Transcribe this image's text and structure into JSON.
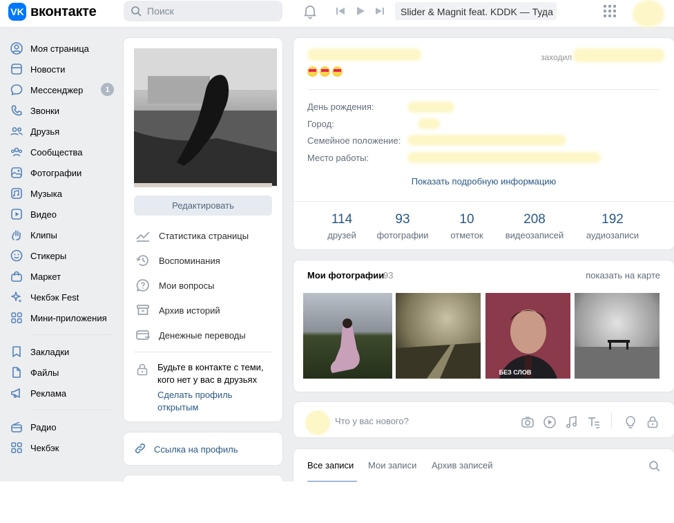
{
  "topbar": {
    "logo_mark": "VK",
    "logo_text": "вконтакте",
    "search_placeholder": "Поиск",
    "player_track": "Slider & Magnit feat. KDDK — Туда",
    "icons": [
      "search-icon",
      "bell-icon",
      "prev-icon",
      "play-icon",
      "next-icon",
      "apps-grid-icon"
    ]
  },
  "sidebar": {
    "items": [
      {
        "label": "Моя страница",
        "icon": "user-icon"
      },
      {
        "label": "Новости",
        "icon": "news-icon"
      },
      {
        "label": "Мессенджер",
        "icon": "chat-icon",
        "badge": "1"
      },
      {
        "label": "Звонки",
        "icon": "phone-icon"
      },
      {
        "label": "Друзья",
        "icon": "friends-icon"
      },
      {
        "label": "Сообщества",
        "icon": "groups-icon"
      },
      {
        "label": "Фотографии",
        "icon": "photo-icon"
      },
      {
        "label": "Музыка",
        "icon": "music-icon"
      },
      {
        "label": "Видео",
        "icon": "video-icon"
      },
      {
        "label": "Клипы",
        "icon": "clips-icon"
      },
      {
        "label": "Стикеры",
        "icon": "sticker-icon"
      },
      {
        "label": "Маркет",
        "icon": "market-icon"
      },
      {
        "label": "Чекбэк Fest",
        "icon": "sparkle-icon"
      },
      {
        "label": "Мини-приложения",
        "icon": "apps-icon"
      }
    ],
    "secondary": [
      {
        "label": "Закладки",
        "icon": "bookmark-icon"
      },
      {
        "label": "Файлы",
        "icon": "file-icon"
      },
      {
        "label": "Реклама",
        "icon": "ads-icon"
      }
    ],
    "tertiary": [
      {
        "label": "Радио",
        "icon": "radio-icon"
      },
      {
        "label": "Чекбэк",
        "icon": "apps-icon"
      }
    ]
  },
  "profile_card": {
    "edit_button": "Редактировать",
    "menu": [
      {
        "label": "Статистика страницы",
        "icon": "stats-icon"
      },
      {
        "label": "Воспоминания",
        "icon": "history-icon"
      },
      {
        "label": "Мои вопросы",
        "icon": "question-icon"
      },
      {
        "label": "Архив историй",
        "icon": "archive-icon"
      },
      {
        "label": "Денежные переводы",
        "icon": "money-transfer-icon"
      }
    ],
    "privacy_text": "Будьте в контакте с теми, кого нет у вас в друзьях",
    "privacy_link": "Сделать профиль открытым"
  },
  "profile_link_card": {
    "label": "Ссылка на профиль",
    "icon": "link-icon"
  },
  "info": {
    "last_seen_prefix": "заходил",
    "labels": [
      "День рождения:",
      "Город:",
      "Семейное положение:",
      "Место работы:"
    ],
    "show_more": "Показать подробную информацию"
  },
  "counters": [
    {
      "value": "114",
      "label": "друзей"
    },
    {
      "value": "93",
      "label": "фотографии"
    },
    {
      "value": "10",
      "label": "отметок"
    },
    {
      "value": "208",
      "label": "видеозаписей"
    },
    {
      "value": "192",
      "label": "аудиозаписи"
    }
  ],
  "photos": {
    "title": "Мои фотографии",
    "count": "93",
    "map_link": "показать на карте",
    "thumb_caption": "БЕЗ СЛОВ"
  },
  "composer": {
    "placeholder": "Что у вас нового?",
    "icons": [
      "camera-icon",
      "video-icon",
      "music-icon",
      "text-format-icon",
      "lightbulb-icon",
      "lock-icon"
    ]
  },
  "wall_tabs": {
    "tabs": [
      "Все записи",
      "Мои записи",
      "Архив записей"
    ],
    "active": "Все записи"
  },
  "colors": {
    "brand": "#0077ff",
    "link": "#2a5885",
    "page_bg": "#edeef0",
    "icon": "#5181b8"
  }
}
